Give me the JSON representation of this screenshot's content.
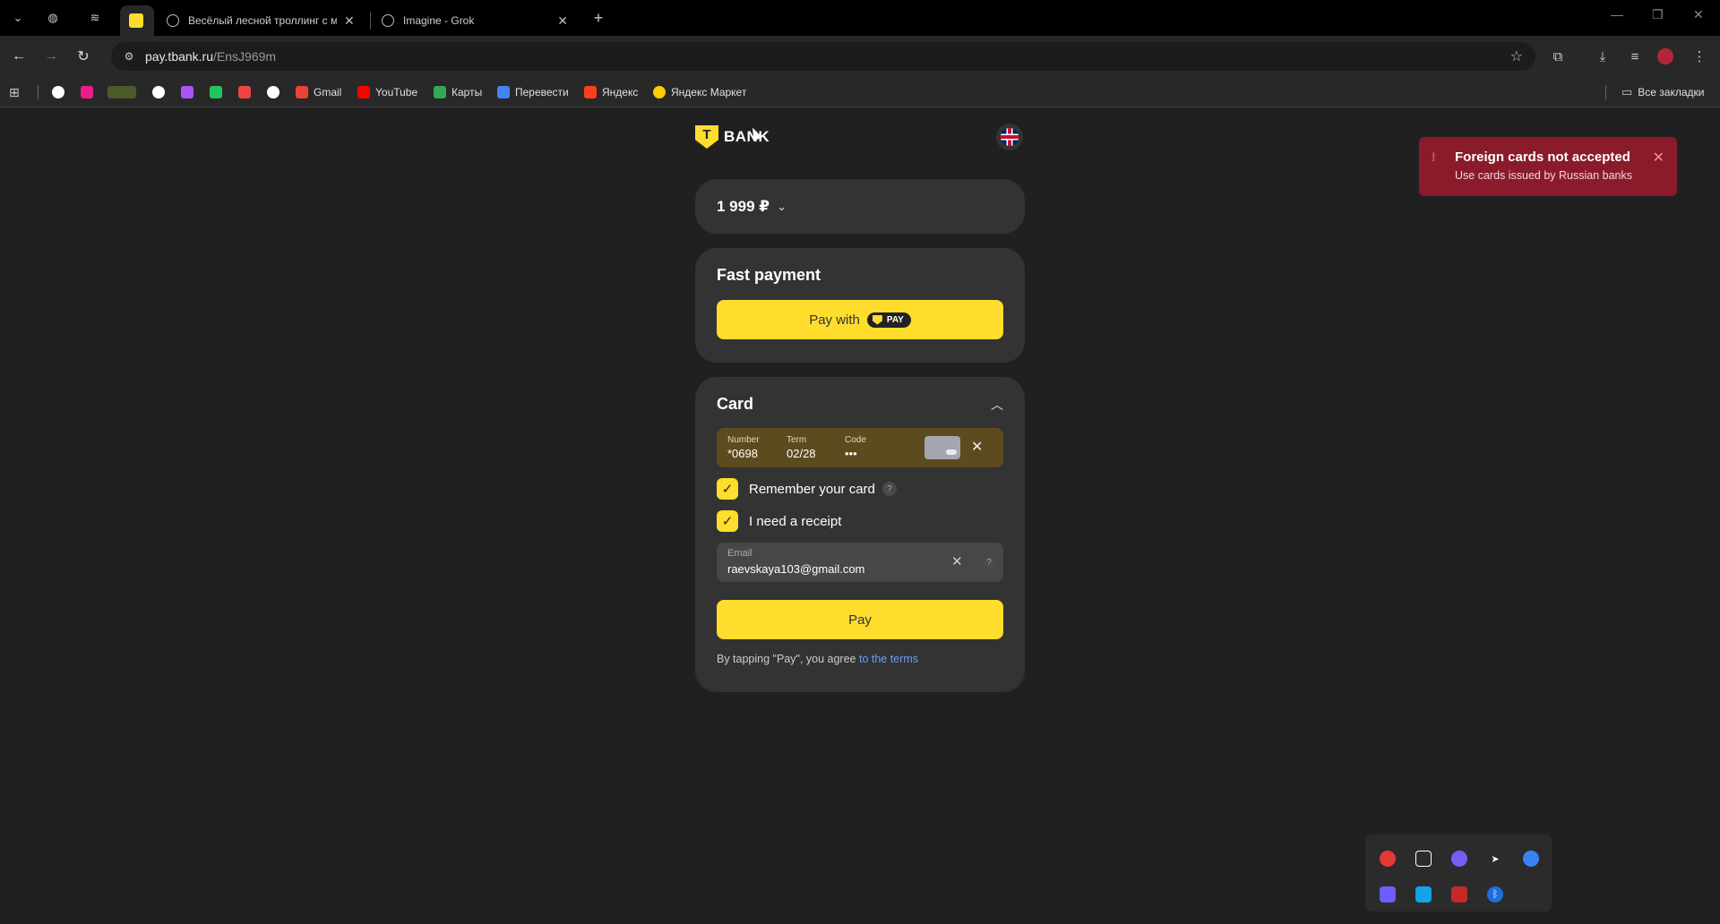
{
  "browser": {
    "tabs": [
      {
        "title": "Весёлый лесной троллинг с м",
        "close": "✕"
      },
      {
        "title": "Imagine - Grok",
        "close": "✕"
      }
    ],
    "new_tab": "+",
    "url_host": "pay.tbank.ru",
    "url_path": "/EnsJ969m",
    "bookmarks": [
      {
        "label": "Gmail",
        "color": "#ea4335"
      },
      {
        "label": "YouTube",
        "color": "#ff0000"
      },
      {
        "label": "Карты",
        "color": "#34a853"
      },
      {
        "label": "Перевести",
        "color": "#4285f4"
      },
      {
        "label": "Яндекс",
        "color": "#fc3f1d"
      },
      {
        "label": "Яндекс Маркет",
        "color": "#ffcc00"
      }
    ],
    "all_bookmarks": "Все закладки"
  },
  "header": {
    "logo_text": "BANK",
    "logo_glyph": "T"
  },
  "amount": {
    "value": "1 999 ₽"
  },
  "fast_payment": {
    "title": "Fast payment",
    "button_label": "Pay with",
    "badge": "PAY"
  },
  "card_section": {
    "title": "Card",
    "number_label": "Number",
    "number_value": "*0698",
    "term_label": "Term",
    "term_value": "02/28",
    "code_label": "Code",
    "code_value": "•••",
    "remember_label": "Remember your card",
    "receipt_label": "I need a receipt",
    "email_label": "Email",
    "email_value": "raevskaya103@gmail.com",
    "pay_label": "Pay",
    "terms_text": "By tapping \"Pay\", you agree ",
    "terms_link": "to the terms"
  },
  "toast": {
    "title": "Foreign cards not accepted",
    "subtitle": "Use cards issued by Russian banks"
  },
  "colors": {
    "accent": "#ffdd2d",
    "error": "#8a1b2b",
    "link": "#6b9cff"
  }
}
